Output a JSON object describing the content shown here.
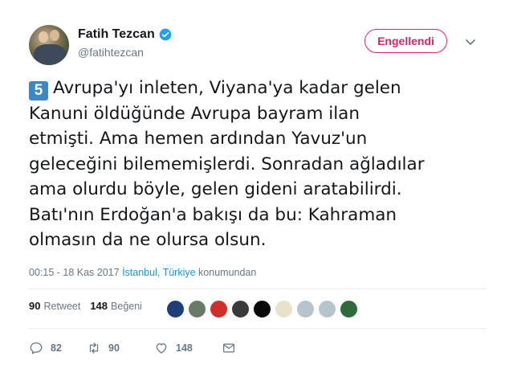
{
  "author": {
    "name": "Fatih Tezcan",
    "handle": "@fatihtezcan"
  },
  "header": {
    "blocked_label": "Engellendi"
  },
  "tweet": {
    "badge": "5",
    "lines": [
      "Avrupa'yı inleten, Viyana'ya kadar gelen",
      "Kanuni öldüğünde Avrupa bayram ilan",
      "etmişti. Ama hemen ardından Yavuz'un",
      "geleceğini bilememişlerdi. Sonradan ağladılar",
      "ama olurdu böyle, gelen gideni aratabilirdi.",
      "Batı'nın Erdoğan'a bakışı da bu: Kahraman",
      "olmasın da ne olursa olsun."
    ]
  },
  "meta": {
    "time": "00:15 - 18 Kas 2017",
    "place": "İstanbul, Türkiye",
    "suffix": "konumundan"
  },
  "stats": {
    "retweets_count": "90",
    "retweets_label": "Retweet",
    "likes_count": "148",
    "likes_label": "Beğeni",
    "liker_avatars": [
      {
        "name": "liker-avatar-1",
        "color": "#1c3f7a"
      },
      {
        "name": "liker-avatar-2",
        "color": "#6b7a68"
      },
      {
        "name": "liker-avatar-3",
        "color": "#d0302a"
      },
      {
        "name": "liker-avatar-4",
        "color": "#3a3a3a"
      },
      {
        "name": "liker-avatar-5",
        "color": "#0a0a0a"
      },
      {
        "name": "liker-avatar-6",
        "color": "#e8e2c8"
      },
      {
        "name": "liker-avatar-7",
        "color": "#b8c4cc"
      },
      {
        "name": "liker-avatar-8",
        "color": "#b8c4cc"
      },
      {
        "name": "liker-avatar-9",
        "color": "#2e6b3a"
      }
    ]
  },
  "actions": {
    "reply_count": "82",
    "retweet_count": "90",
    "like_count": "148"
  },
  "colors": {
    "accent": "#1b95e0",
    "blocked": "#e0245e",
    "badge": "#3b88c3"
  }
}
